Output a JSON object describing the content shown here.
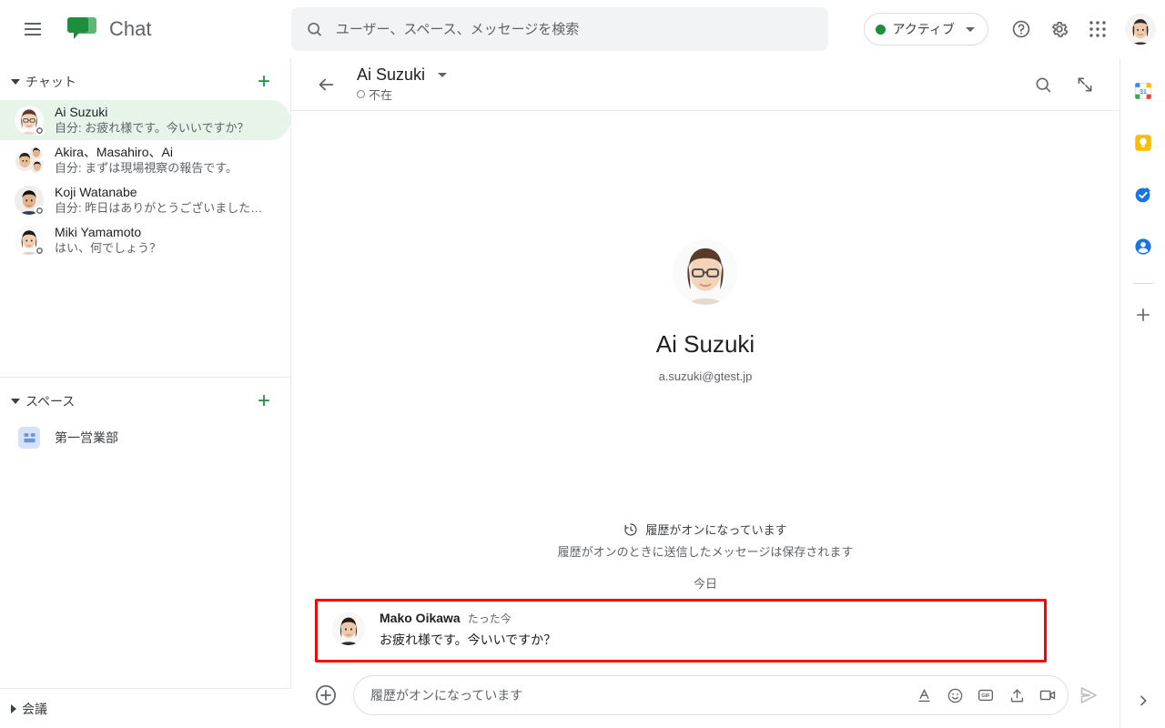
{
  "app": {
    "name": "Chat",
    "menu_icon": "hamburger-icon",
    "logo_icon": "google-chat-logo"
  },
  "search": {
    "placeholder": "ユーザー、スペース、メッセージを検索",
    "value": "",
    "icon": "search-icon"
  },
  "topbar": {
    "status_label": "アクティブ",
    "status_color": "#1e8e3e",
    "help_icon": "help-circle-icon",
    "settings_icon": "gear-icon",
    "apps_icon": "apps-grid-icon",
    "account_avatar": "account-avatar"
  },
  "sidebar": {
    "chat_section": {
      "label": "チャット",
      "add_label": "+",
      "expanded": true
    },
    "chats": [
      {
        "name": "Ai Suzuki",
        "preview": "自分: お疲れ様です。今いいですか？",
        "selected": true,
        "presence": "away"
      },
      {
        "name": "Akira、Masahiro、Ai",
        "preview": "自分: まずは現場視察の報告です。",
        "selected": false,
        "presence": "none"
      },
      {
        "name": "Koji Watanabe",
        "preview": "自分: 昨日はありがとうございました…",
        "selected": false,
        "presence": "away"
      },
      {
        "name": "Miki Yamamoto",
        "preview": "はい、何でしょう？",
        "selected": false,
        "presence": "away"
      }
    ],
    "spaces_section": {
      "label": "スペース",
      "add_label": "+",
      "expanded": true
    },
    "spaces": [
      {
        "name": "第一営業部",
        "icon": "space-grid-icon"
      }
    ],
    "meetings_section": {
      "label": "会議",
      "expanded": false
    }
  },
  "conversation": {
    "back_icon": "back-arrow-icon",
    "title": "Ai Suzuki",
    "title_caret": "chevron-down-icon",
    "status": "不在",
    "status_type": "away",
    "search_icon": "search-icon",
    "collapse_icon": "collapse-icon",
    "profile": {
      "name": "Ai Suzuki",
      "email": "a.suzuki@gtest.jp",
      "avatar": "ai-suzuki-avatar"
    },
    "history_notice": {
      "icon": "history-clock-icon",
      "title": "履歴がオンになっています",
      "subtitle": "履歴がオンのときに送信したメッセージは保存されます"
    },
    "day_separator": "今日",
    "messages": [
      {
        "author": "Mako Oikawa",
        "time": "たった今",
        "text": "お疲れ様です。今いいですか？",
        "highlighted": true,
        "highlight_color": "#ff0000"
      }
    ]
  },
  "composer": {
    "add_icon": "plus-circle-icon",
    "placeholder": "履歴がオンになっています",
    "value": "",
    "tools": [
      {
        "name": "format-icon",
        "label": "A"
      },
      {
        "name": "emoji-icon",
        "label": "☺"
      },
      {
        "name": "gif-icon",
        "label": "GIF"
      },
      {
        "name": "upload-icon",
        "label": "↑"
      },
      {
        "name": "video-icon",
        "label": "▭"
      }
    ],
    "send_icon": "send-icon"
  },
  "right_rail": {
    "items": [
      {
        "name": "calendar-icon",
        "label": "31"
      },
      {
        "name": "keep-icon",
        "label": ""
      },
      {
        "name": "tasks-icon",
        "label": ""
      },
      {
        "name": "contacts-icon",
        "label": ""
      }
    ],
    "add_icon": "plus-icon",
    "expand_icon": "chevron-right-icon"
  }
}
